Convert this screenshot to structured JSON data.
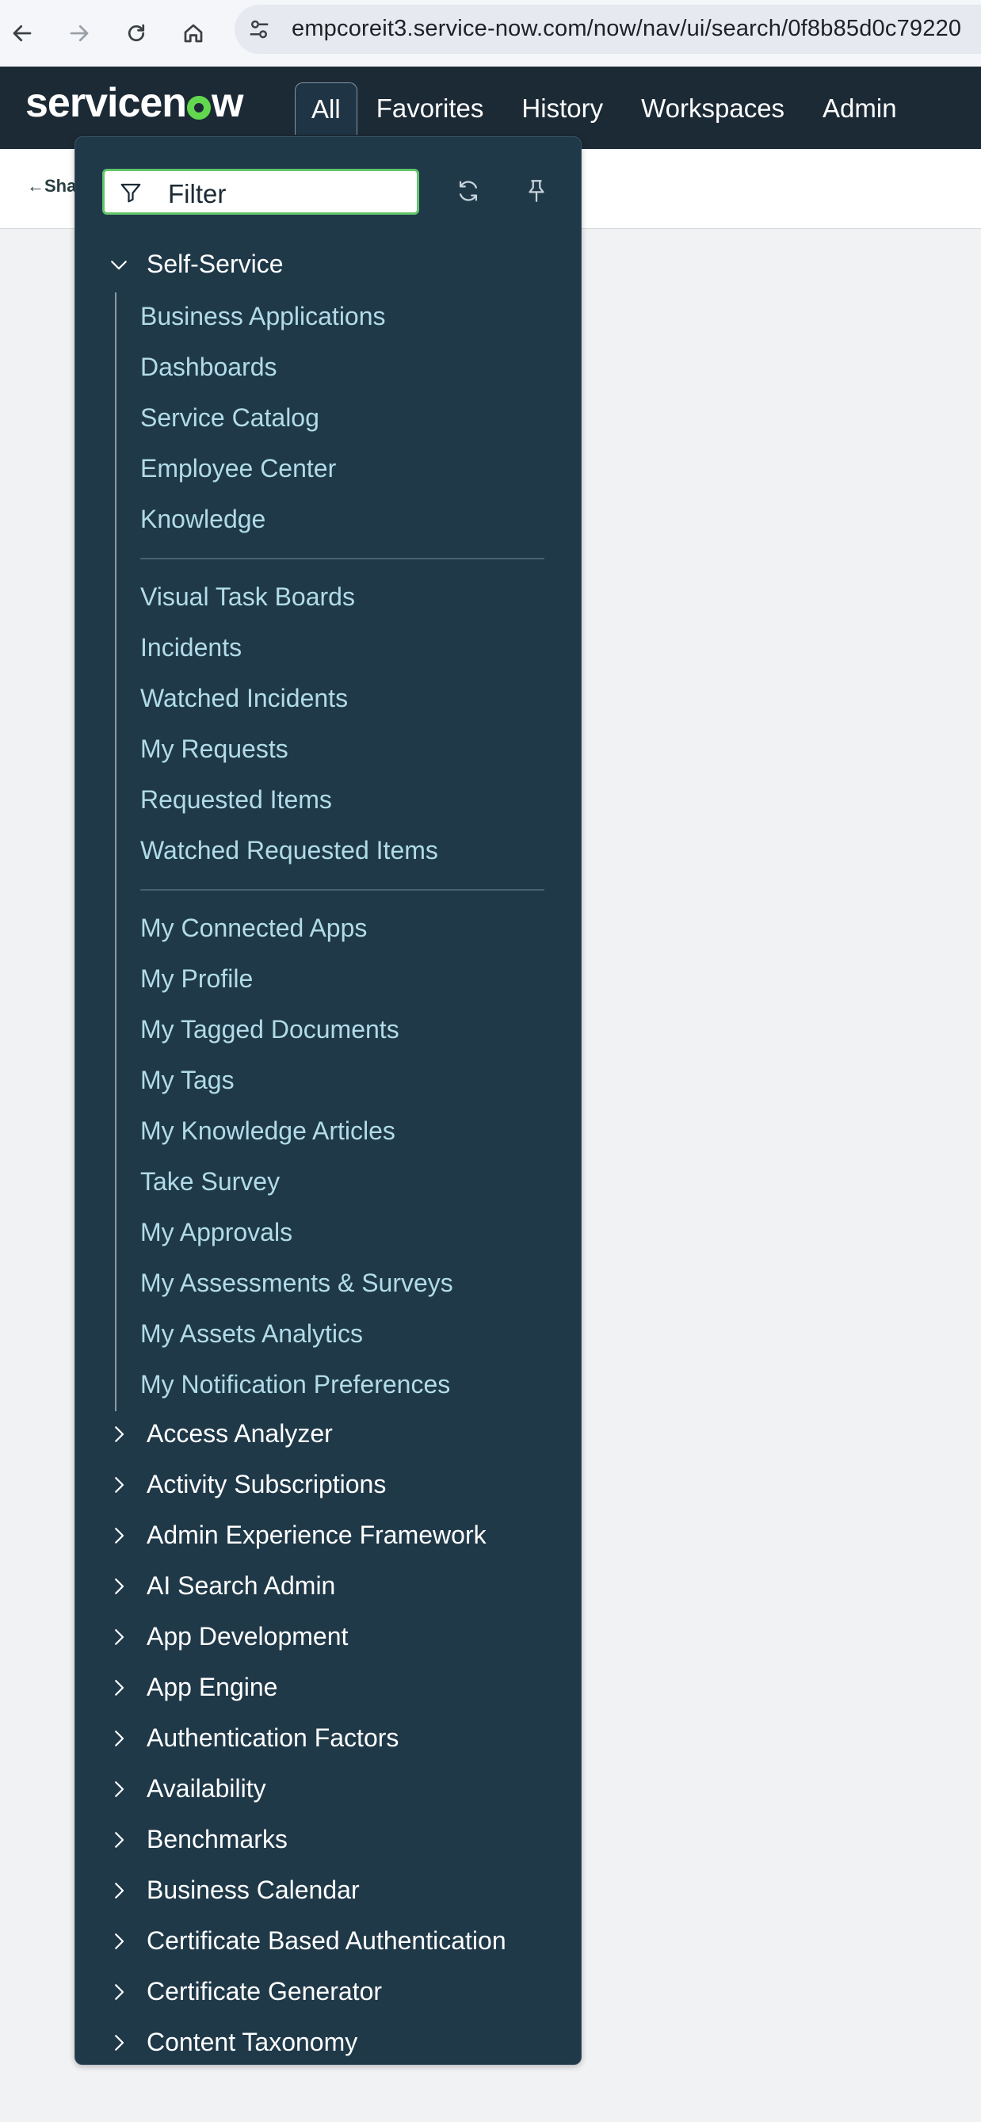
{
  "browser": {
    "url": "empcoreit3.service-now.com/now/nav/ui/search/0f8b85d0c79220"
  },
  "header": {
    "logo": "servicenow",
    "tabs": [
      {
        "label": "All"
      },
      {
        "label": "Favorites"
      },
      {
        "label": "History"
      },
      {
        "label": "Workspaces"
      },
      {
        "label": "Admin"
      }
    ]
  },
  "subheader": {
    "back_label": "Sha"
  },
  "menu": {
    "filter_placeholder": "Filter",
    "section_open": "Self-Service",
    "group1": [
      "Business Applications",
      "Dashboards",
      "Service Catalog",
      "Employee Center",
      "Knowledge"
    ],
    "group2": [
      "Visual Task Boards",
      "Incidents",
      "Watched Incidents",
      "My Requests",
      "Requested Items",
      "Watched Requested Items"
    ],
    "group3": [
      "My Connected Apps",
      "My Profile",
      "My Tagged Documents",
      "My Tags",
      "My Knowledge Articles",
      "Take Survey",
      "My Approvals",
      "My Assessments & Surveys",
      "My Assets Analytics",
      "My Notification Preferences"
    ],
    "collapsed_sections": [
      "Access Analyzer",
      "Activity Subscriptions",
      "Admin Experience Framework",
      "AI Search Admin",
      "App Development",
      "App Engine",
      "Authentication Factors",
      "Availability",
      "Benchmarks",
      "Business Calendar",
      "Certificate Based Authentication",
      "Certificate Generator",
      "Content Taxonomy"
    ]
  },
  "colors": {
    "header_bg": "#1c2a36",
    "menu_bg": "#1f3949",
    "link_color": "#b2dbe8",
    "filter_border": "#63c36b",
    "logo_accent": "#62d84e"
  }
}
